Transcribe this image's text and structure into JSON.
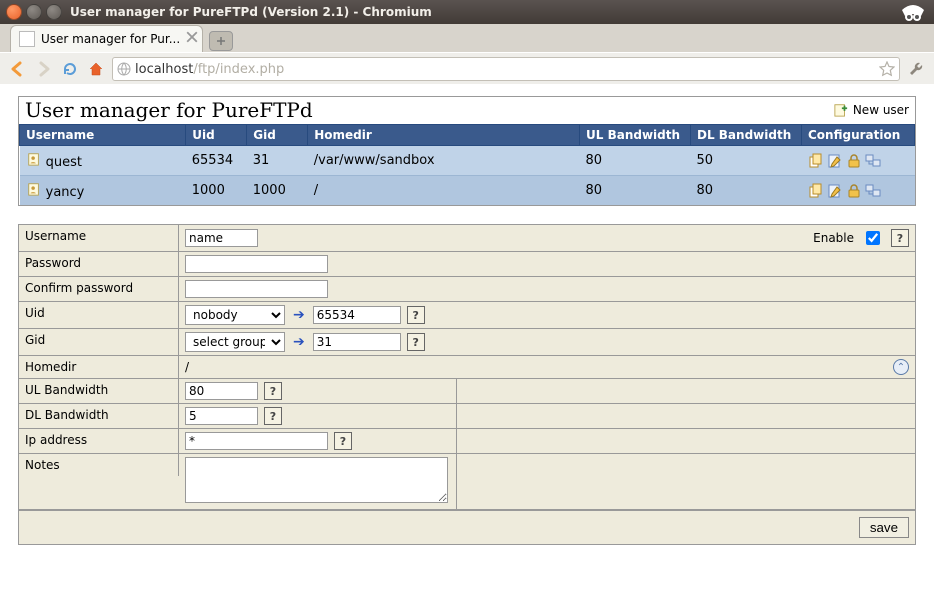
{
  "window": {
    "title": "User manager for PureFTPd (Version 2.1) - Chromium",
    "tab_title": "User manager for Pur..."
  },
  "url": {
    "host": "localhost",
    "path": "/ftp/index.php"
  },
  "page": {
    "title": "User manager for PureFTPd",
    "new_user": "New user"
  },
  "table": {
    "headers": {
      "username": "Username",
      "uid": "Uid",
      "gid": "Gid",
      "homedir": "Homedir",
      "ul": "UL Bandwidth",
      "dl": "DL Bandwidth",
      "config": "Configuration"
    },
    "rows": [
      {
        "username": "quest",
        "uid": "65534",
        "gid": "31",
        "homedir": "/var/www/sandbox",
        "ul": "80",
        "dl": "50"
      },
      {
        "username": "yancy",
        "uid": "1000",
        "gid": "1000",
        "homedir": "/",
        "ul": "80",
        "dl": "80"
      }
    ]
  },
  "form": {
    "labels": {
      "username": "Username",
      "password": "Password",
      "confirm": "Confirm password",
      "uid": "Uid",
      "gid": "Gid",
      "homedir": "Homedir",
      "ul": "UL Bandwidth",
      "dl": "DL Bandwidth",
      "ip": "Ip address",
      "notes": "Notes",
      "enable": "Enable"
    },
    "values": {
      "username": "name",
      "password": "",
      "confirm": "",
      "uid_select": "nobody",
      "uid": "65534",
      "gid_select": "select group",
      "gid": "31",
      "homedir": "/",
      "ul": "80",
      "dl": "5",
      "ip": "*",
      "notes": ""
    },
    "save": "save"
  }
}
